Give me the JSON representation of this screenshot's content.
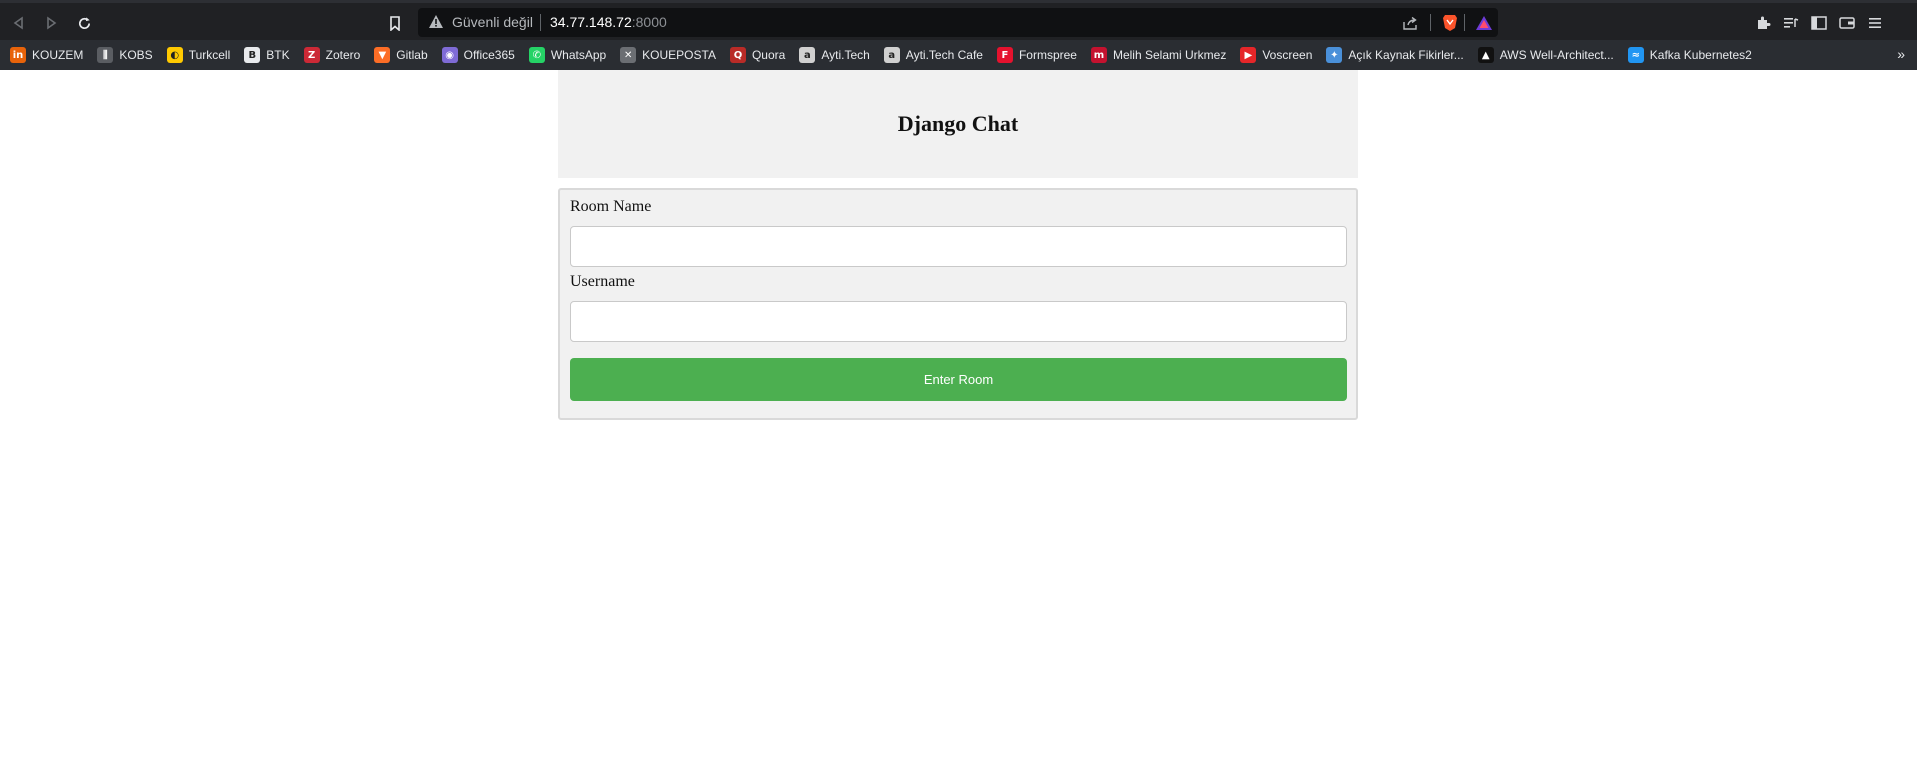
{
  "browser": {
    "security_label": "Güvenli değil",
    "url_host": "34.77.148.72",
    "url_port": ":8000"
  },
  "bookmarks": [
    {
      "label": "KOUZEM",
      "icon": "kouzem-icon",
      "color": "#e8630a",
      "glyph": "in"
    },
    {
      "label": "KOBS",
      "icon": "kobs-icon",
      "color": "#5a5d62",
      "glyph": "⫼"
    },
    {
      "label": "Turkcell",
      "icon": "turkcell-icon",
      "color": "#ffc900",
      "glyph": "◐"
    },
    {
      "label": "BTK",
      "icon": "btk-icon",
      "color": "#e8eaed",
      "glyph": "B"
    },
    {
      "label": "Zotero",
      "icon": "zotero-icon",
      "color": "#cc2936",
      "glyph": "Z"
    },
    {
      "label": "Gitlab",
      "icon": "gitlab-icon",
      "color": "#fc6d26",
      "glyph": "▼"
    },
    {
      "label": "Office365",
      "icon": "office365-icon",
      "color": "#7f6bd6",
      "glyph": "◉"
    },
    {
      "label": "WhatsApp",
      "icon": "whatsapp-icon",
      "color": "#25d366",
      "glyph": "✆"
    },
    {
      "label": "KOUEPOSTA",
      "icon": "kouposta-icon",
      "color": "#6b6e73",
      "glyph": "✕"
    },
    {
      "label": "Quora",
      "icon": "quora-icon",
      "color": "#b92b27",
      "glyph": "Q"
    },
    {
      "label": "Ayti.Tech",
      "icon": "aytitech-icon",
      "color": "#d0d0d0",
      "glyph": "a"
    },
    {
      "label": "Ayti.Tech Cafe",
      "icon": "aytitech-cafe-icon",
      "color": "#d0d0d0",
      "glyph": "a"
    },
    {
      "label": "Formspree",
      "icon": "formspree-icon",
      "color": "#e5122e",
      "glyph": "F"
    },
    {
      "label": "Melih Selami Urkmez",
      "icon": "melih-icon",
      "color": "#c4122f",
      "glyph": "m"
    },
    {
      "label": "Voscreen",
      "icon": "voscreen-icon",
      "color": "#e52629",
      "glyph": "▶"
    },
    {
      "label": "Açık Kaynak Fikirler...",
      "icon": "acik-kaynak-icon",
      "color": "#4a90d9",
      "glyph": "✦"
    },
    {
      "label": "AWS Well-Architect...",
      "icon": "aws-icon",
      "color": "#111111",
      "glyph": "▲"
    },
    {
      "label": "Kafka Kubernetes2",
      "icon": "kafka-icon",
      "color": "#2196f3",
      "glyph": "≈"
    }
  ],
  "page": {
    "title": "Django Chat",
    "room_label": "Room Name",
    "room_value": "",
    "username_label": "Username",
    "username_value": "",
    "submit_label": "Enter Room"
  },
  "colors": {
    "accent": "#4caf50",
    "panel": "#f1f1f1"
  }
}
